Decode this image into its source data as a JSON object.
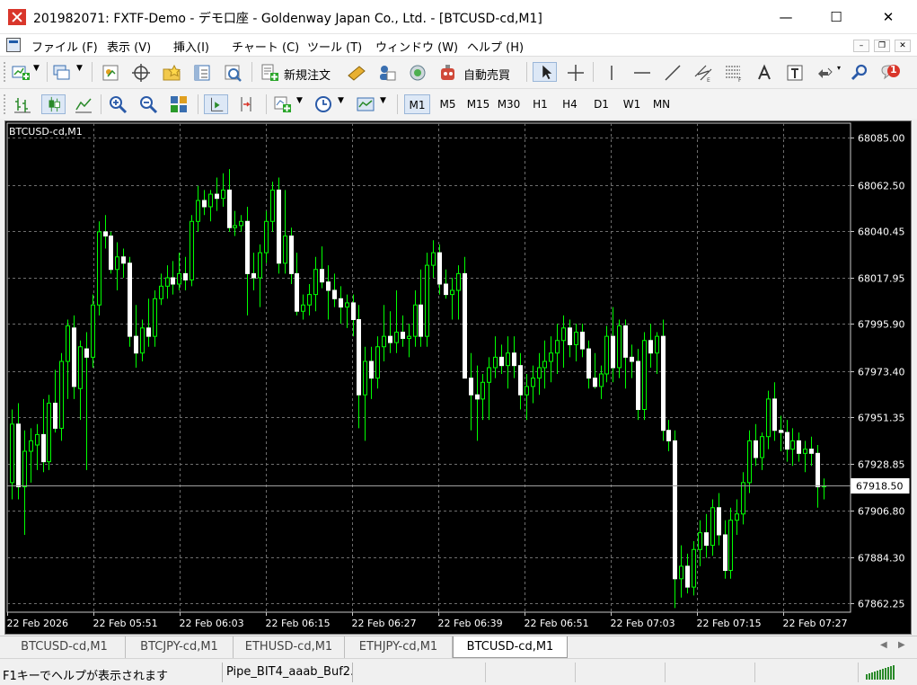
{
  "window": {
    "title": "201982071: FXTF-Demo - デモ口座 - Goldenway Japan Co., Ltd. - [BTCUSD-cd,M1]",
    "min_glyph": "—",
    "max_glyph": "☐",
    "close_glyph": "✕"
  },
  "menu": {
    "items": [
      "ファイル (F)",
      "表示 (V)",
      "挿入(I)",
      "チャート (C)",
      "ツール (T)",
      "ウィンドウ (W)",
      "ヘルプ (H)"
    ],
    "mdi_min": "–",
    "mdi_restore": "❐",
    "mdi_close": "✕"
  },
  "toolbar1": {
    "new_order_label": "新規注文",
    "auto_trade_label": "自動売買",
    "notification_count": "1",
    "icons": [
      "new-chart-icon",
      "profiles-icon",
      "market-watch-icon",
      "data-window-icon",
      "navigator-icon",
      "terminal-icon",
      "strategy-tester-icon",
      "new-order-icon",
      "metaeditor-icon",
      "signals-icon",
      "vps-icon",
      "auto-trading-icon",
      "cursor-icon",
      "crosshair-icon",
      "vertical-line-icon",
      "horizontal-line-icon",
      "trendline-icon",
      "equidistant-channel-icon",
      "fibonacci-icon",
      "text-icon",
      "text-label-icon",
      "arrows-icon",
      "search-icon",
      "notifications-icon"
    ]
  },
  "toolbar2": {
    "timeframes": [
      "M1",
      "M5",
      "M15",
      "M30",
      "H1",
      "H4",
      "D1",
      "W1",
      "MN"
    ],
    "active_timeframe": "M1",
    "icons": [
      "bar-chart-icon",
      "candlestick-icon",
      "line-chart-icon",
      "zoom-in-icon",
      "zoom-out-icon",
      "tile-windows-icon",
      "autoscroll-icon",
      "chart-shift-icon",
      "indicators-icon",
      "periods-icon",
      "templates-icon"
    ]
  },
  "chart_data": {
    "type": "candlestick",
    "symbol_label": "BTCUSD-cd,M1",
    "y_ticks": [
      68085.0,
      68062.5,
      68040.45,
      68017.95,
      67995.9,
      67973.4,
      67951.35,
      67928.85,
      67906.8,
      67884.3,
      67862.25
    ],
    "y_tick_labels": [
      "68085.00",
      "68062.50",
      "68040.45",
      "68017.95",
      "67995.90",
      "67973.40",
      "67951.35",
      "67928.85",
      "67906.80",
      "67884.30",
      "67862.25"
    ],
    "ylim": [
      67858.0,
      68092.0
    ],
    "x_tick_labels": [
      "22 Feb 2026",
      "22 Feb 05:51",
      "22 Feb 06:03",
      "22 Feb 06:15",
      "22 Feb 06:27",
      "22 Feb 06:39",
      "22 Feb 06:51",
      "22 Feb 07:03",
      "22 Feb 07:15",
      "22 Feb 07:27"
    ],
    "current_price": 67918.5,
    "current_price_label": "67918.50",
    "grid": true,
    "colors": {
      "background": "#000000",
      "candle": "#ffffff",
      "bull": "#00ff00",
      "grid": "#6e6e6e",
      "axis_text": "#ffffff",
      "price_line": "#a0a0a0"
    },
    "candles": [
      {
        "o": 67920,
        "h": 67955,
        "l": 67912,
        "c": 67948
      },
      {
        "o": 67948,
        "h": 67958,
        "l": 67912,
        "c": 67918
      },
      {
        "o": 67918,
        "h": 67945,
        "l": 67895,
        "c": 67935
      },
      {
        "o": 67935,
        "h": 67946,
        "l": 67920,
        "c": 67940
      },
      {
        "o": 67938,
        "h": 67948,
        "l": 67926,
        "c": 67943
      },
      {
        "o": 67943,
        "h": 67960,
        "l": 67925,
        "c": 67930
      },
      {
        "o": 67930,
        "h": 67962,
        "l": 67926,
        "c": 67958
      },
      {
        "o": 67958,
        "h": 67974,
        "l": 67944,
        "c": 67946
      },
      {
        "o": 67946,
        "h": 67982,
        "l": 67940,
        "c": 67978
      },
      {
        "o": 67978,
        "h": 67998,
        "l": 67960,
        "c": 67995
      },
      {
        "o": 67994,
        "h": 68000,
        "l": 67960,
        "c": 67966
      },
      {
        "o": 67965,
        "h": 67988,
        "l": 67950,
        "c": 67985
      },
      {
        "o": 67984,
        "h": 67992,
        "l": 67926,
        "c": 67980
      },
      {
        "o": 67980,
        "h": 68010,
        "l": 67975,
        "c": 68005
      },
      {
        "o": 68005,
        "h": 68045,
        "l": 68000,
        "c": 68040
      },
      {
        "o": 68040,
        "h": 68048,
        "l": 68032,
        "c": 68038
      },
      {
        "o": 68038,
        "h": 68040,
        "l": 68020,
        "c": 68022
      },
      {
        "o": 68022,
        "h": 68035,
        "l": 68012,
        "c": 68028
      },
      {
        "o": 68028,
        "h": 68032,
        "l": 68018,
        "c": 68025
      },
      {
        "o": 68025,
        "h": 68028,
        "l": 67985,
        "c": 67990
      },
      {
        "o": 67990,
        "h": 68005,
        "l": 67975,
        "c": 67982
      },
      {
        "o": 67982,
        "h": 67998,
        "l": 67978,
        "c": 67994
      },
      {
        "o": 67994,
        "h": 68008,
        "l": 67985,
        "c": 67990
      },
      {
        "o": 67990,
        "h": 68012,
        "l": 67985,
        "c": 68008
      },
      {
        "o": 68008,
        "h": 68020,
        "l": 68005,
        "c": 68014
      },
      {
        "o": 68014,
        "h": 68024,
        "l": 68008,
        "c": 68018
      },
      {
        "o": 68018,
        "h": 68026,
        "l": 68010,
        "c": 68015
      },
      {
        "o": 68015,
        "h": 68030,
        "l": 68012,
        "c": 68020
      },
      {
        "o": 68020,
        "h": 68028,
        "l": 68012,
        "c": 68017
      },
      {
        "o": 68017,
        "h": 68048,
        "l": 68014,
        "c": 68045
      },
      {
        "o": 68045,
        "h": 68062,
        "l": 68040,
        "c": 68055
      },
      {
        "o": 68055,
        "h": 68060,
        "l": 68048,
        "c": 68052
      },
      {
        "o": 68052,
        "h": 68060,
        "l": 68045,
        "c": 68058
      },
      {
        "o": 68058,
        "h": 68066,
        "l": 68050,
        "c": 68056
      },
      {
        "o": 68056,
        "h": 68068,
        "l": 68052,
        "c": 68060
      },
      {
        "o": 68060,
        "h": 68070,
        "l": 68040,
        "c": 68042
      },
      {
        "o": 68042,
        "h": 68050,
        "l": 68038,
        "c": 68043
      },
      {
        "o": 68043,
        "h": 68048,
        "l": 68040,
        "c": 68045
      },
      {
        "o": 68045,
        "h": 68052,
        "l": 68000,
        "c": 68020
      },
      {
        "o": 68020,
        "h": 68030,
        "l": 68012,
        "c": 68018
      },
      {
        "o": 68018,
        "h": 68034,
        "l": 68004,
        "c": 68030
      },
      {
        "o": 68030,
        "h": 68050,
        "l": 68025,
        "c": 68045
      },
      {
        "o": 68045,
        "h": 68064,
        "l": 68040,
        "c": 68060
      },
      {
        "o": 68060,
        "h": 68066,
        "l": 68020,
        "c": 68025
      },
      {
        "o": 68025,
        "h": 68060,
        "l": 68020,
        "c": 68038
      },
      {
        "o": 68038,
        "h": 68042,
        "l": 68015,
        "c": 68020
      },
      {
        "o": 68020,
        "h": 68030,
        "l": 68000,
        "c": 68002
      },
      {
        "o": 68002,
        "h": 68010,
        "l": 67998,
        "c": 68005
      },
      {
        "o": 68005,
        "h": 68015,
        "l": 68000,
        "c": 68010
      },
      {
        "o": 68010,
        "h": 68028,
        "l": 68002,
        "c": 68022
      },
      {
        "o": 68022,
        "h": 68033,
        "l": 68013,
        "c": 68016
      },
      {
        "o": 68016,
        "h": 68024,
        "l": 67998,
        "c": 68012
      },
      {
        "o": 68012,
        "h": 68020,
        "l": 68004,
        "c": 68008
      },
      {
        "o": 68008,
        "h": 68014,
        "l": 67996,
        "c": 68004
      },
      {
        "o": 68004,
        "h": 68010,
        "l": 67994,
        "c": 68006
      },
      {
        "o": 68006,
        "h": 68010,
        "l": 67990,
        "c": 67998
      },
      {
        "o": 67998,
        "h": 68005,
        "l": 67946,
        "c": 67962
      },
      {
        "o": 67962,
        "h": 67985,
        "l": 67940,
        "c": 67978
      },
      {
        "o": 67978,
        "h": 67985,
        "l": 67960,
        "c": 67970
      },
      {
        "o": 67970,
        "h": 67990,
        "l": 67965,
        "c": 67985
      },
      {
        "o": 67985,
        "h": 68005,
        "l": 67978,
        "c": 67990
      },
      {
        "o": 67990,
        "h": 68002,
        "l": 67982,
        "c": 67987
      },
      {
        "o": 67987,
        "h": 68012,
        "l": 67982,
        "c": 67992
      },
      {
        "o": 67992,
        "h": 68000,
        "l": 67985,
        "c": 67989
      },
      {
        "o": 67989,
        "h": 67996,
        "l": 67980,
        "c": 67990
      },
      {
        "o": 67990,
        "h": 68012,
        "l": 67985,
        "c": 68005
      },
      {
        "o": 68005,
        "h": 68022,
        "l": 67985,
        "c": 67990
      },
      {
        "o": 67990,
        "h": 68030,
        "l": 67985,
        "c": 68024
      },
      {
        "o": 68024,
        "h": 68036,
        "l": 68018,
        "c": 68030
      },
      {
        "o": 68030,
        "h": 68034,
        "l": 68010,
        "c": 68015
      },
      {
        "o": 68015,
        "h": 68022,
        "l": 68008,
        "c": 68010
      },
      {
        "o": 68010,
        "h": 68018,
        "l": 67998,
        "c": 68012
      },
      {
        "o": 68012,
        "h": 68024,
        "l": 67998,
        "c": 68020
      },
      {
        "o": 68020,
        "h": 68028,
        "l": 67985,
        "c": 67970
      },
      {
        "o": 67970,
        "h": 67982,
        "l": 67945,
        "c": 67962
      },
      {
        "o": 67962,
        "h": 67976,
        "l": 67940,
        "c": 67960
      },
      {
        "o": 67960,
        "h": 67972,
        "l": 67950,
        "c": 67968
      },
      {
        "o": 67968,
        "h": 67980,
        "l": 67950,
        "c": 67975
      },
      {
        "o": 67975,
        "h": 67990,
        "l": 67970,
        "c": 67980
      },
      {
        "o": 67980,
        "h": 67986,
        "l": 67972,
        "c": 67976
      },
      {
        "o": 67976,
        "h": 67990,
        "l": 67965,
        "c": 67982
      },
      {
        "o": 67982,
        "h": 67990,
        "l": 67970,
        "c": 67976
      },
      {
        "o": 67976,
        "h": 67982,
        "l": 67955,
        "c": 67962
      },
      {
        "o": 67962,
        "h": 67972,
        "l": 67950,
        "c": 67966
      },
      {
        "o": 67966,
        "h": 67976,
        "l": 67958,
        "c": 67970
      },
      {
        "o": 67970,
        "h": 67982,
        "l": 67962,
        "c": 67975
      },
      {
        "o": 67975,
        "h": 67988,
        "l": 67965,
        "c": 67978
      },
      {
        "o": 67978,
        "h": 67990,
        "l": 67968,
        "c": 67982
      },
      {
        "o": 67982,
        "h": 67996,
        "l": 67972,
        "c": 67988
      },
      {
        "o": 67988,
        "h": 68000,
        "l": 67975,
        "c": 67994
      },
      {
        "o": 67994,
        "h": 67998,
        "l": 67980,
        "c": 67986
      },
      {
        "o": 67986,
        "h": 67996,
        "l": 67978,
        "c": 67992
      },
      {
        "o": 67992,
        "h": 67996,
        "l": 67980,
        "c": 67984
      },
      {
        "o": 67984,
        "h": 67988,
        "l": 67965,
        "c": 67970
      },
      {
        "o": 67970,
        "h": 67982,
        "l": 67965,
        "c": 67966
      },
      {
        "o": 67966,
        "h": 67976,
        "l": 67960,
        "c": 67972
      },
      {
        "o": 67972,
        "h": 67995,
        "l": 67968,
        "c": 67990
      },
      {
        "o": 67990,
        "h": 68004,
        "l": 67968,
        "c": 67975
      },
      {
        "o": 67975,
        "h": 67998,
        "l": 67970,
        "c": 67995
      },
      {
        "o": 67995,
        "h": 67998,
        "l": 67965,
        "c": 67980
      },
      {
        "o": 67980,
        "h": 67986,
        "l": 67970,
        "c": 67978
      },
      {
        "o": 67978,
        "h": 67984,
        "l": 67950,
        "c": 67955
      },
      {
        "o": 67955,
        "h": 67992,
        "l": 67950,
        "c": 67988
      },
      {
        "o": 67988,
        "h": 67996,
        "l": 67975,
        "c": 67982
      },
      {
        "o": 67982,
        "h": 67992,
        "l": 67972,
        "c": 67990
      },
      {
        "o": 67990,
        "h": 67998,
        "l": 67940,
        "c": 67945
      },
      {
        "o": 67945,
        "h": 67950,
        "l": 67935,
        "c": 67940
      },
      {
        "o": 67940,
        "h": 67945,
        "l": 67860,
        "c": 67874
      },
      {
        "o": 67874,
        "h": 67890,
        "l": 67865,
        "c": 67880
      },
      {
        "o": 67880,
        "h": 67886,
        "l": 67867,
        "c": 67870
      },
      {
        "o": 67870,
        "h": 67892,
        "l": 67866,
        "c": 67888
      },
      {
        "o": 67888,
        "h": 67902,
        "l": 67880,
        "c": 67896
      },
      {
        "o": 67896,
        "h": 67905,
        "l": 67884,
        "c": 67890
      },
      {
        "o": 67890,
        "h": 67912,
        "l": 67885,
        "c": 67908
      },
      {
        "o": 67908,
        "h": 67915,
        "l": 67890,
        "c": 67895
      },
      {
        "o": 67895,
        "h": 67902,
        "l": 67874,
        "c": 67878
      },
      {
        "o": 67878,
        "h": 67908,
        "l": 67874,
        "c": 67902
      },
      {
        "o": 67902,
        "h": 67912,
        "l": 67895,
        "c": 67905
      },
      {
        "o": 67905,
        "h": 67925,
        "l": 67900,
        "c": 67920
      },
      {
        "o": 67920,
        "h": 67945,
        "l": 67915,
        "c": 67940
      },
      {
        "o": 67940,
        "h": 67948,
        "l": 67928,
        "c": 67932
      },
      {
        "o": 67932,
        "h": 67944,
        "l": 67926,
        "c": 67942
      },
      {
        "o": 67942,
        "h": 67964,
        "l": 67936,
        "c": 67960
      },
      {
        "o": 67960,
        "h": 67968,
        "l": 67940,
        "c": 67945
      },
      {
        "o": 67945,
        "h": 67952,
        "l": 67935,
        "c": 67944
      },
      {
        "o": 67944,
        "h": 67950,
        "l": 67930,
        "c": 67936
      },
      {
        "o": 67936,
        "h": 67946,
        "l": 67928,
        "c": 67940
      },
      {
        "o": 67940,
        "h": 67944,
        "l": 67930,
        "c": 67934
      },
      {
        "o": 67934,
        "h": 67940,
        "l": 67925,
        "c": 67936
      },
      {
        "o": 67936,
        "h": 67942,
        "l": 67928,
        "c": 67934
      },
      {
        "o": 67934,
        "h": 67938,
        "l": 67908,
        "c": 67918
      },
      {
        "o": 67918,
        "h": 67922,
        "l": 67912,
        "c": 67918.5
      }
    ]
  },
  "tabs": {
    "items": [
      "BTCUSD-cd,M1",
      "BTCJPY-cd,M1",
      "ETHUSD-cd,M1",
      "ETHJPY-cd,M1",
      "BTCUSD-cd,M1"
    ],
    "active_index": 4,
    "prev_glyph": "◀",
    "next_glyph": "▶"
  },
  "status": {
    "help": "F1キーでヘルプが表示されます",
    "profile": "Pipe_BIT4_aaab_Buf2.."
  }
}
